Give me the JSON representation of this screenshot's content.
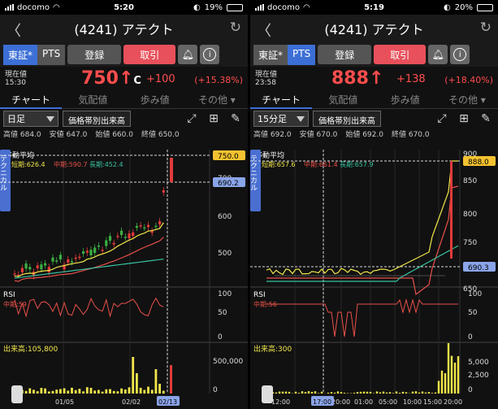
{
  "panels": [
    {
      "status": {
        "carrier": "docomo",
        "time": "5:20",
        "battery": "19%"
      },
      "title": "(4241) アテクト",
      "market": {
        "tse": "東証*",
        "pts": "PTS",
        "active": "tse"
      },
      "register_label": "登録",
      "trade_label": "取引",
      "price": {
        "label_line1": "現在値",
        "label_line2": "15:30",
        "value": "750",
        "arrow": "↑",
        "flag": "C",
        "change": "+100",
        "change_pct": "(+15.38%)"
      },
      "tabs": [
        "チャート",
        "気配値",
        "歩み値",
        "その他"
      ],
      "tab_chevron": "▾",
      "interval": "日足",
      "band_button": "価格帯別出来高",
      "ohlc": {
        "high_label": "高値",
        "high": "684.0",
        "low_label": "安値",
        "low": "647.0",
        "open_label": "始値",
        "open": "660.0",
        "close_label": "終値",
        "close": "650.0"
      },
      "technical_label": "テクニカル",
      "ma": {
        "title": "移動平均",
        "short": "短期:626.4",
        "mid": "中期:590.7",
        "long": "長期:452.4"
      },
      "rsi": {
        "title": "RSI",
        "mid": "中期:59"
      },
      "volume": {
        "title": "出来高:105,800"
      },
      "price_axis": [
        "700",
        "600",
        "500"
      ],
      "price_tags": [
        "750.0",
        "690.2"
      ],
      "rsi_axis": [
        "100",
        "50",
        "0"
      ],
      "vol_axis": [
        "500,000",
        "0"
      ],
      "date_axis": [
        "01/05",
        "02/02"
      ],
      "cursor_date": "02/13",
      "colors": {
        "up": "#e23b3b",
        "down": "#3cb043",
        "short": "#f2e64b",
        "mid": "#e8504a",
        "long": "#37c2a0",
        "tag": "#f4c230",
        "cursorTag": "#8aa4e8"
      }
    },
    {
      "status": {
        "carrier": "docomo",
        "time": "5:19",
        "battery": "20%"
      },
      "title": "(4241) アテクト",
      "market": {
        "tse": "東証*",
        "pts": "PTS",
        "active": "pts"
      },
      "register_label": "登録",
      "trade_label": "取引",
      "price": {
        "label_line1": "現在値",
        "label_line2": "23:58",
        "value": "888",
        "arrow": "↑",
        "flag": "",
        "change": "+138",
        "change_pct": "(+18.40%)"
      },
      "tabs": [
        "チャート",
        "気配値",
        "歩み値",
        "その他"
      ],
      "tab_chevron": "▾",
      "interval": "15分足",
      "band_button": "価格帯別出来高",
      "ohlc": {
        "high_label": "高値",
        "high": "692.0",
        "low_label": "安値",
        "low": "670.0",
        "open_label": "始値",
        "open": "692.0",
        "close_label": "終値",
        "close": "670.0"
      },
      "technical_label": "テクニカル",
      "ma": {
        "title": "移動平均",
        "short": "短期:657.6",
        "mid": "中期:661.4",
        "long": "長期:657.9"
      },
      "rsi": {
        "title": "RSI",
        "mid": "中期:56"
      },
      "volume": {
        "title": "出来高:300"
      },
      "price_axis": [
        "900",
        "850",
        "800",
        "750",
        "700",
        "650"
      ],
      "price_tags": [
        "888.0",
        "690.3"
      ],
      "rsi_axis": [
        "100",
        "50",
        "0"
      ],
      "vol_axis": [
        "5,000",
        "2,500",
        "0"
      ],
      "date_axis": [
        "12:00",
        "17:00",
        "20:00",
        "01:00",
        "05:00",
        "10:00",
        "15:00",
        "20:00"
      ],
      "cursor_date": "17:00",
      "colors": {
        "up": "#e23b3b",
        "down": "#3cb043",
        "short": "#f2e64b",
        "mid": "#e8504a",
        "long": "#37c2a0",
        "tag": "#f4c230",
        "cursorTag": "#8aa4e8"
      }
    }
  ]
}
